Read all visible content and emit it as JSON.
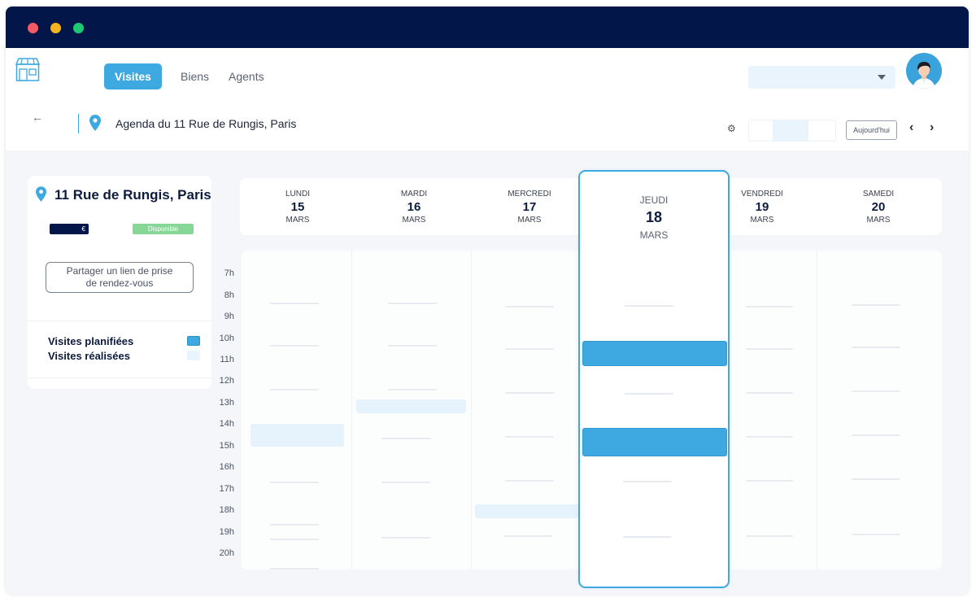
{
  "nav": {
    "tabs": [
      {
        "label": "Visites"
      },
      {
        "label": "Biens"
      },
      {
        "label": "Agents"
      }
    ]
  },
  "toolbar": {
    "back_icon": "arrow-left-icon",
    "title": "Agenda du 11 Rue de Rungis, Paris",
    "today_label": "Aujourd'hui"
  },
  "sidebar": {
    "property_title": "11 Rue de Rungis, Paris",
    "price_label": "€",
    "status_label": "Disponible",
    "share_line1": "Partager un lien de prise",
    "share_line2": "de rendez-vous",
    "legend": [
      {
        "label": "Visites planifiées",
        "color": "#3da9e0"
      },
      {
        "label": "Visites réalisées",
        "color": "#eaf4fd"
      }
    ]
  },
  "days": [
    {
      "name": "LUNDI",
      "num": "15",
      "month": "MARS"
    },
    {
      "name": "MARDI",
      "num": "16",
      "month": "MARS"
    },
    {
      "name": "MERCREDI",
      "num": "17",
      "month": "MARS"
    },
    {
      "name": "JEUDI",
      "num": "18",
      "month": "MARS"
    },
    {
      "name": "VENDREDI",
      "num": "19",
      "month": "MARS"
    },
    {
      "name": "SAMEDI",
      "num": "20",
      "month": "MARS"
    }
  ],
  "hours": [
    "7h",
    "8h",
    "9h",
    "10h",
    "11h",
    "12h",
    "13h",
    "14h",
    "15h",
    "16h",
    "17h",
    "18h",
    "19h",
    "20h"
  ],
  "colors": {
    "accent": "#3da9e0",
    "titlebar": "#03164a",
    "available": "#86d696"
  }
}
